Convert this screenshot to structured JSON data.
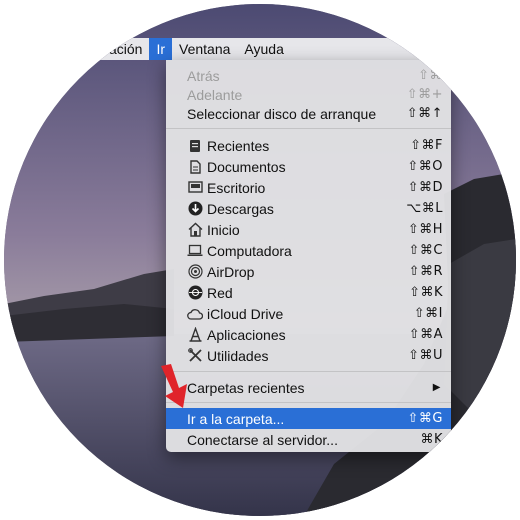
{
  "menubar": {
    "items": [
      "ación",
      "Ir",
      "Ventana",
      "Ayuda"
    ]
  },
  "menu": {
    "items": [
      {
        "label": "Atrás",
        "shortcut": "⇧⌘",
        "icon": "",
        "disabled": true
      },
      {
        "label": "Adelante",
        "shortcut": "⇧⌘+",
        "icon": "",
        "disabled": true
      },
      {
        "label": "Seleccionar disco de arranque",
        "shortcut": "⇧⌘↑",
        "icon": ""
      },
      {
        "label": "Recientes",
        "shortcut": "⇧⌘F",
        "icon": "recents-icon"
      },
      {
        "label": "Documentos",
        "shortcut": "⇧⌘O",
        "icon": "documents-icon"
      },
      {
        "label": "Escritorio",
        "shortcut": "⇧⌘D",
        "icon": "desktop-icon"
      },
      {
        "label": "Descargas",
        "shortcut": "⌥⌘L",
        "icon": "downloads-icon"
      },
      {
        "label": "Inicio",
        "shortcut": "⇧⌘H",
        "icon": "home-icon"
      },
      {
        "label": "Computadora",
        "shortcut": "⇧⌘C",
        "icon": "computer-icon"
      },
      {
        "label": "AirDrop",
        "shortcut": "⇧⌘R",
        "icon": "airdrop-icon"
      },
      {
        "label": "Red",
        "shortcut": "⇧⌘K",
        "icon": "network-icon"
      },
      {
        "label": "iCloud Drive",
        "shortcut": "⇧⌘I",
        "icon": "icloud-icon"
      },
      {
        "label": "Aplicaciones",
        "shortcut": "⇧⌘A",
        "icon": "applications-icon"
      },
      {
        "label": "Utilidades",
        "shortcut": "⇧⌘U",
        "icon": "utilities-icon"
      },
      {
        "label": "Carpetas recientes",
        "shortcut": "▶",
        "icon": "submenu-arrow-icon"
      },
      {
        "label": "Ir a la carpeta...",
        "shortcut": "⇧⌘G",
        "icon": "",
        "highlighted": true
      },
      {
        "label": "Conectarse al servidor...",
        "shortcut": "⌘K",
        "icon": ""
      }
    ]
  },
  "colors": {
    "highlight": "#2a6fd6",
    "menu_background": "#e2e2e4",
    "arrow": "#e0242a"
  }
}
